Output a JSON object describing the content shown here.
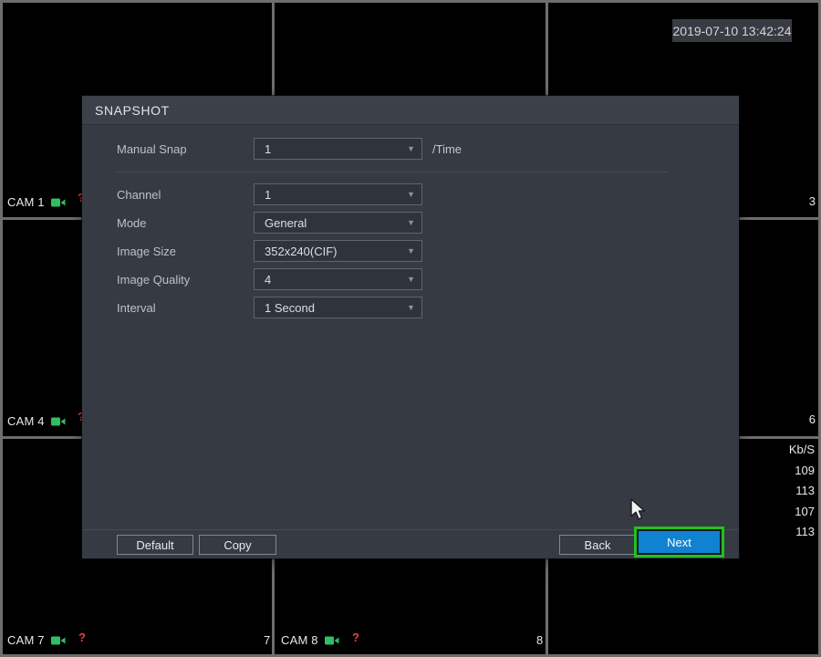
{
  "system": {
    "timestamp": "2019-07-10 13:42:24"
  },
  "grid": {
    "cam1_label": "CAM 1",
    "cam4_label": "CAM 4",
    "cam7_label": "CAM 7",
    "cam8_label": "CAM 8",
    "question_mark": "?",
    "ch3_number": "3",
    "ch6_number": "6",
    "ch7_number": "7",
    "ch8_number": "8",
    "bitrate": {
      "header": "Kb/S",
      "values": [
        "109",
        "113",
        "107",
        "113"
      ]
    }
  },
  "dialog": {
    "title": "SNAPSHOT",
    "fields": [
      {
        "label": "Manual Snap",
        "value": "1",
        "suffix": "/Time"
      },
      {
        "label": "Channel",
        "value": "1"
      },
      {
        "label": "Mode",
        "value": "General"
      },
      {
        "label": "Image Size",
        "value": "352x240(CIF)"
      },
      {
        "label": "Image Quality",
        "value": "4"
      },
      {
        "label": "Interval",
        "value": "1 Second"
      }
    ],
    "buttons": {
      "default": "Default",
      "copy": "Copy",
      "back": "Back",
      "next": "Next"
    }
  },
  "icons": {
    "chevron_down": "▼"
  },
  "colors": {
    "next_button_bg": "#1181d2",
    "next_button_focus_border": "#1ec41e",
    "camera_icon_green": "#31bd66",
    "warning_red": "#e04343",
    "grid_line": "#6e6e6b",
    "dialog_bg": "#353a43"
  }
}
